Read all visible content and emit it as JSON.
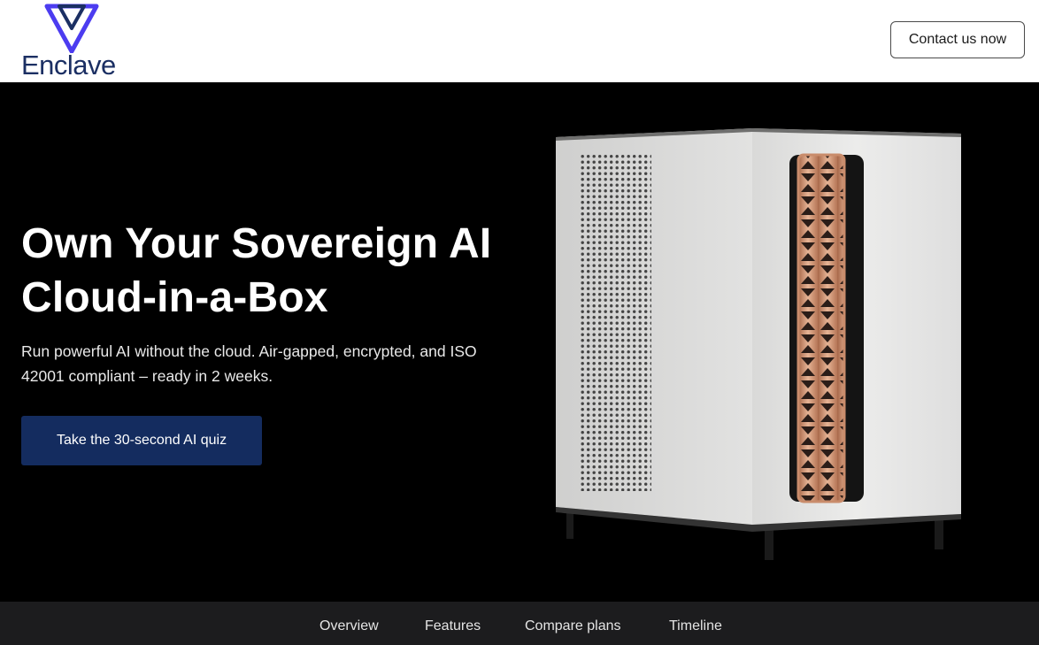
{
  "brand": {
    "name": "Enclave",
    "logo_icon": "enclave-triangle-logo-icon",
    "primary": "#1b2f63",
    "accent": "#4c3cf0"
  },
  "header": {
    "contact_label": "Contact us now"
  },
  "hero": {
    "title_line1": "Own Your Sovereign AI",
    "title_line2": "Cloud-in-a-Box",
    "subtitle": "Run powerful AI without the cloud. Air-gapped, encrypted, and ISO 42001 compliant – ready in 2 weeks.",
    "cta_label": "Take the 30-second AI quiz",
    "cta_color": "#142c5f",
    "product_image": "enclave-server-box-image"
  },
  "nav": {
    "items": [
      {
        "label": "Overview"
      },
      {
        "label": "Features"
      },
      {
        "label": "Compare plans"
      },
      {
        "label": "Timeline"
      }
    ]
  }
}
